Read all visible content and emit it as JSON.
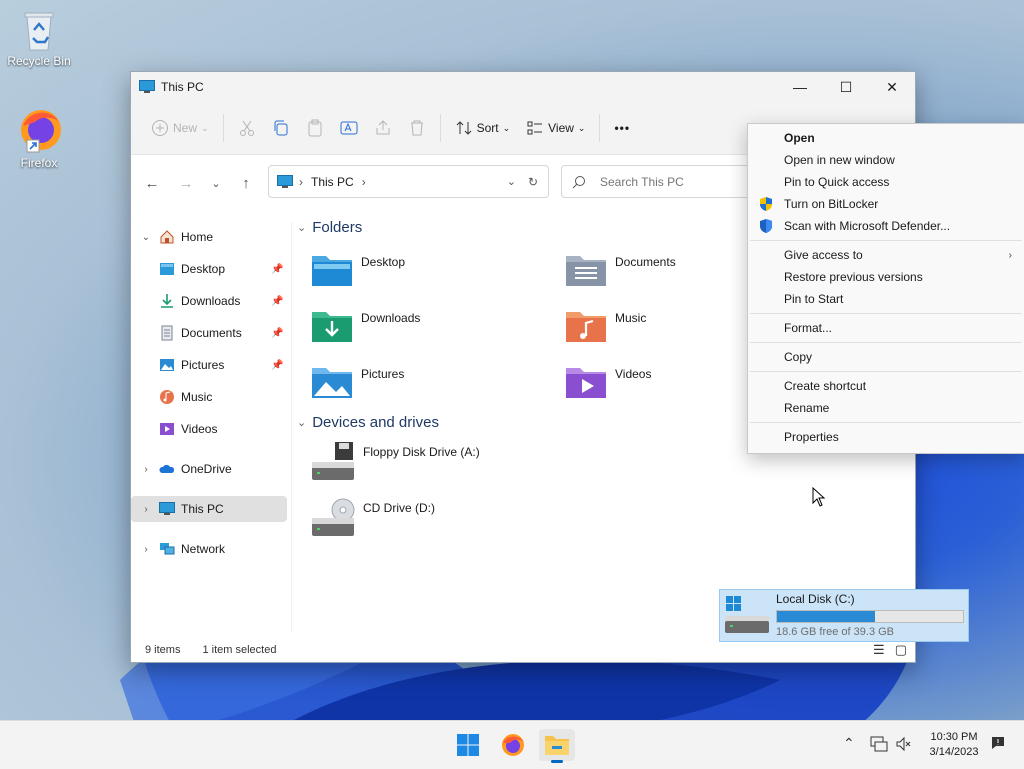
{
  "desktop": {
    "icons": [
      {
        "label": "Recycle Bin"
      },
      {
        "label": "Firefox"
      }
    ]
  },
  "window": {
    "title": "This PC",
    "controls": {
      "minimize": "—",
      "maximize": "☐",
      "close": "✕"
    },
    "toolbar": {
      "new_label": "New",
      "sort_label": "Sort",
      "view_label": "View",
      "more_label": "•••"
    },
    "address": {
      "path": "This PC"
    },
    "search": {
      "placeholder": "Search This PC"
    },
    "sidebar": {
      "items": [
        {
          "label": "Home"
        },
        {
          "label": "Desktop"
        },
        {
          "label": "Downloads"
        },
        {
          "label": "Documents"
        },
        {
          "label": "Pictures"
        },
        {
          "label": "Music"
        },
        {
          "label": "Videos"
        },
        {
          "label": "OneDrive"
        },
        {
          "label": "This PC"
        },
        {
          "label": "Network"
        }
      ]
    },
    "content": {
      "folders_title": "Folders",
      "folders": [
        {
          "label": "Desktop"
        },
        {
          "label": "Documents"
        },
        {
          "label": "Downloads"
        },
        {
          "label": "Music"
        },
        {
          "label": "Pictures"
        },
        {
          "label": "Videos"
        }
      ],
      "devices_title": "Devices and drives",
      "drives": [
        {
          "label": "Floppy Disk Drive (A:)"
        },
        {
          "label": "Local Disk (C:)",
          "free_text": "18.6 GB free of 39.3 GB",
          "used_fraction": 0.527
        },
        {
          "label": "CD Drive (D:)"
        }
      ]
    },
    "status": {
      "items": "9 items",
      "selected": "1 item selected"
    }
  },
  "context_menu": {
    "items": [
      {
        "label": "Open"
      },
      {
        "label": "Open in new window"
      },
      {
        "label": "Pin to Quick access"
      },
      {
        "label": "Turn on BitLocker"
      },
      {
        "label": "Scan with Microsoft Defender..."
      },
      {
        "label": "Give access to"
      },
      {
        "label": "Restore previous versions"
      },
      {
        "label": "Pin to Start"
      },
      {
        "label": "Format..."
      },
      {
        "label": "Copy"
      },
      {
        "label": "Create shortcut"
      },
      {
        "label": "Rename"
      },
      {
        "label": "Properties"
      }
    ]
  },
  "taskbar": {
    "time": "10:30 PM",
    "date": "3/14/2023"
  },
  "colors": {
    "accent": "#0067c0",
    "selection": "#cce4f7",
    "drive_bar": "#2a8ad4"
  }
}
